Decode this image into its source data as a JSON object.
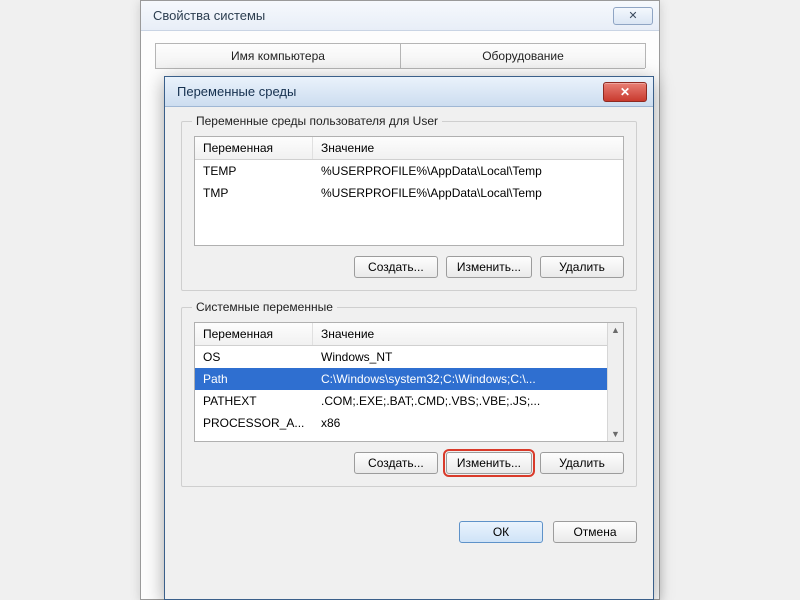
{
  "parent": {
    "title": "Свойства системы",
    "close_glyph": "✕",
    "tabs": [
      "Имя компьютера",
      "Оборудование"
    ]
  },
  "dialog": {
    "title": "Переменные среды",
    "close_glyph": "✕",
    "user_group": {
      "legend": "Переменные среды пользователя для User",
      "columns": [
        "Переменная",
        "Значение"
      ],
      "rows": [
        {
          "name": "TEMP",
          "value": "%USERPROFILE%\\AppData\\Local\\Temp"
        },
        {
          "name": "TMP",
          "value": "%USERPROFILE%\\AppData\\Local\\Temp"
        }
      ],
      "buttons": {
        "create": "Создать...",
        "edit": "Изменить...",
        "delete": "Удалить"
      }
    },
    "sys_group": {
      "legend": "Системные переменные",
      "columns": [
        "Переменная",
        "Значение"
      ],
      "rows": [
        {
          "name": "OS",
          "value": "Windows_NT",
          "selected": false
        },
        {
          "name": "Path",
          "value": "C:\\Windows\\system32;C:\\Windows;C:\\...",
          "selected": true
        },
        {
          "name": "PATHEXT",
          "value": ".COM;.EXE;.BAT;.CMD;.VBS;.VBE;.JS;...",
          "selected": false
        },
        {
          "name": "PROCESSOR_A...",
          "value": "x86",
          "selected": false
        }
      ],
      "buttons": {
        "create": "Создать...",
        "edit": "Изменить...",
        "delete": "Удалить"
      }
    },
    "footer": {
      "ok": "ОК",
      "cancel": "Отмена"
    }
  }
}
